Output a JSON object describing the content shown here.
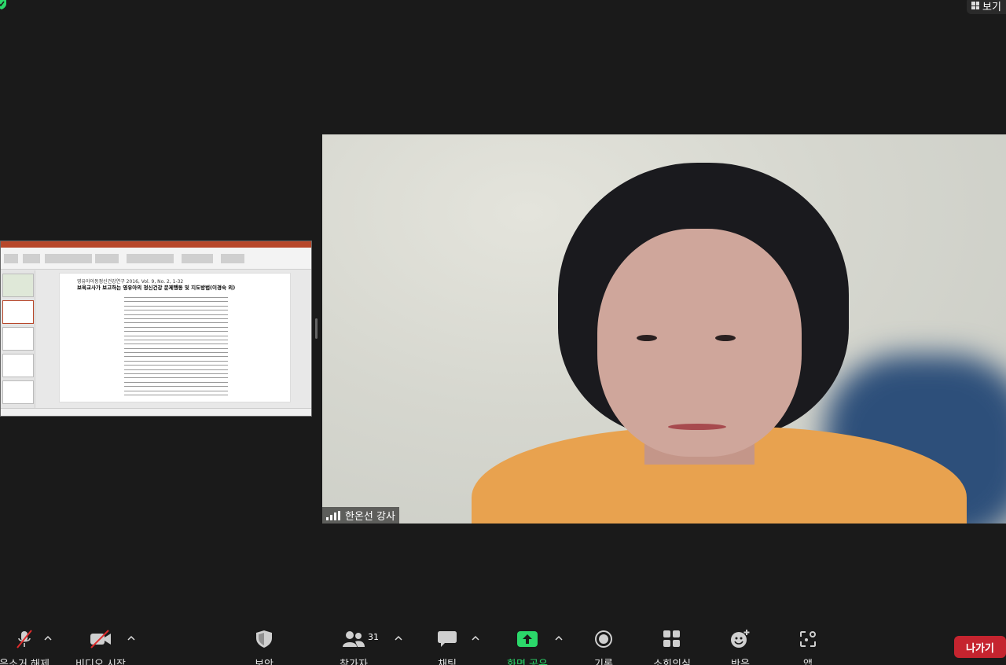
{
  "top": {
    "view_label": "보기"
  },
  "shared_screen": {
    "slide_journal_line": "영유아아동정신건강연구 2016, Vol. 9, No. 2, 1-32",
    "slide_heading": "보육교사가 보고하는 영유아의 정신건강 문제행동 및 지도방법(이경숙 외)"
  },
  "speaker": {
    "name": "한온선 강사"
  },
  "toolbar": {
    "audio_label": "음소거 해제",
    "video_label": "비디오 시작",
    "security_label": "보안",
    "participants_label": "참가자",
    "participants_count": "31",
    "chat_label": "채팅",
    "share_label": "화면 공유",
    "record_label": "기록",
    "breakout_label": "소회의실",
    "reactions_label": "반응",
    "apps_label": "앱",
    "leave_label": "나가기"
  },
  "colors": {
    "background": "#1a1a1a",
    "share_green": "#2bd86a",
    "leave_red": "#c5242f",
    "mute_slash_red": "#e02b2b"
  }
}
